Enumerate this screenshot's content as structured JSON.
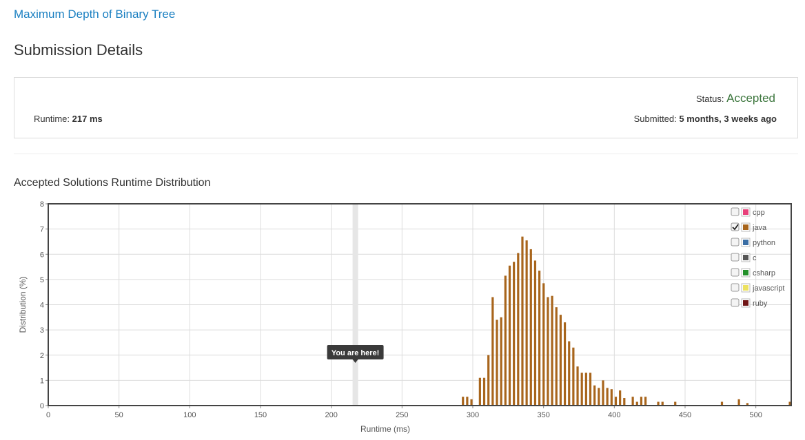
{
  "problem": {
    "title": "Maximum Depth of Binary Tree"
  },
  "page": {
    "heading": "Submission Details"
  },
  "details": {
    "runtime_label": "Runtime:",
    "runtime_value": "217 ms",
    "status_label": "Status:",
    "status_value": "Accepted",
    "submitted_label": "Submitted:",
    "submitted_value": "5 months, 3 weeks ago"
  },
  "chart_section": {
    "title": "Accepted Solutions Runtime Distribution"
  },
  "colors": {
    "cpp": "#e8407a",
    "java": "#a8651c",
    "python": "#3a6ea5",
    "c": "#555555",
    "csharp": "#23902a",
    "javascript": "#ece160",
    "ruby": "#701516",
    "marker": "#e6e6e6",
    "tooltip": "#3a3a3a",
    "accepted": "#3c763d",
    "link": "#1a7fc1"
  },
  "chart_data": {
    "type": "bar",
    "xlabel": "Runtime (ms)",
    "ylabel": "Distribution (%)",
    "xlim": [
      0,
      525
    ],
    "ylim": [
      0,
      8
    ],
    "xticks": [
      0,
      50,
      100,
      150,
      200,
      250,
      300,
      350,
      400,
      450,
      500
    ],
    "yticks": [
      0,
      1,
      2,
      3,
      4,
      5,
      6,
      7,
      8
    ],
    "grid": true,
    "legend_position": "top-right",
    "legend": [
      {
        "name": "cpp",
        "checked": false
      },
      {
        "name": "java",
        "checked": true
      },
      {
        "name": "python",
        "checked": false
      },
      {
        "name": "c",
        "checked": false
      },
      {
        "name": "csharp",
        "checked": false
      },
      {
        "name": "javascript",
        "checked": false
      },
      {
        "name": "ruby",
        "checked": false
      }
    ],
    "marker": {
      "x": 217,
      "label": "You are here!"
    },
    "series": [
      {
        "name": "java",
        "x": [
          293,
          296,
          299,
          302,
          305,
          308,
          311,
          314,
          317,
          320,
          323,
          326,
          329,
          332,
          335,
          338,
          341,
          344,
          347,
          350,
          353,
          356,
          359,
          362,
          365,
          368,
          371,
          374,
          377,
          380,
          383,
          386,
          389,
          392,
          395,
          398,
          401,
          404,
          407,
          410,
          413,
          416,
          419,
          422,
          425,
          428,
          431,
          434,
          437,
          440,
          443,
          446,
          449,
          452,
          455,
          458,
          461,
          464,
          467,
          470,
          473,
          476,
          479,
          482,
          485,
          488,
          491,
          494,
          497,
          500,
          503,
          506,
          509,
          512,
          515,
          518,
          521,
          524
        ],
        "values": [
          0.35,
          0.35,
          0.25,
          0,
          1.1,
          1.1,
          2.0,
          4.3,
          3.4,
          3.5,
          5.15,
          5.55,
          5.7,
          6.05,
          6.7,
          6.55,
          6.2,
          5.75,
          5.35,
          4.85,
          4.3,
          4.35,
          3.9,
          3.6,
          3.3,
          2.55,
          2.3,
          1.55,
          1.3,
          1.3,
          1.3,
          0.8,
          0.7,
          1.0,
          0.7,
          0.65,
          0.35,
          0.6,
          0.3,
          0,
          0.35,
          0.15,
          0.35,
          0.35,
          0,
          0,
          0.15,
          0.15,
          0,
          0,
          0.15,
          0,
          0,
          0,
          0,
          0,
          0,
          0,
          0,
          0,
          0,
          0.15,
          0,
          0,
          0,
          0.25,
          0,
          0.1,
          0,
          0,
          0,
          0,
          0,
          0,
          0,
          0,
          0,
          0.15
        ]
      }
    ]
  }
}
